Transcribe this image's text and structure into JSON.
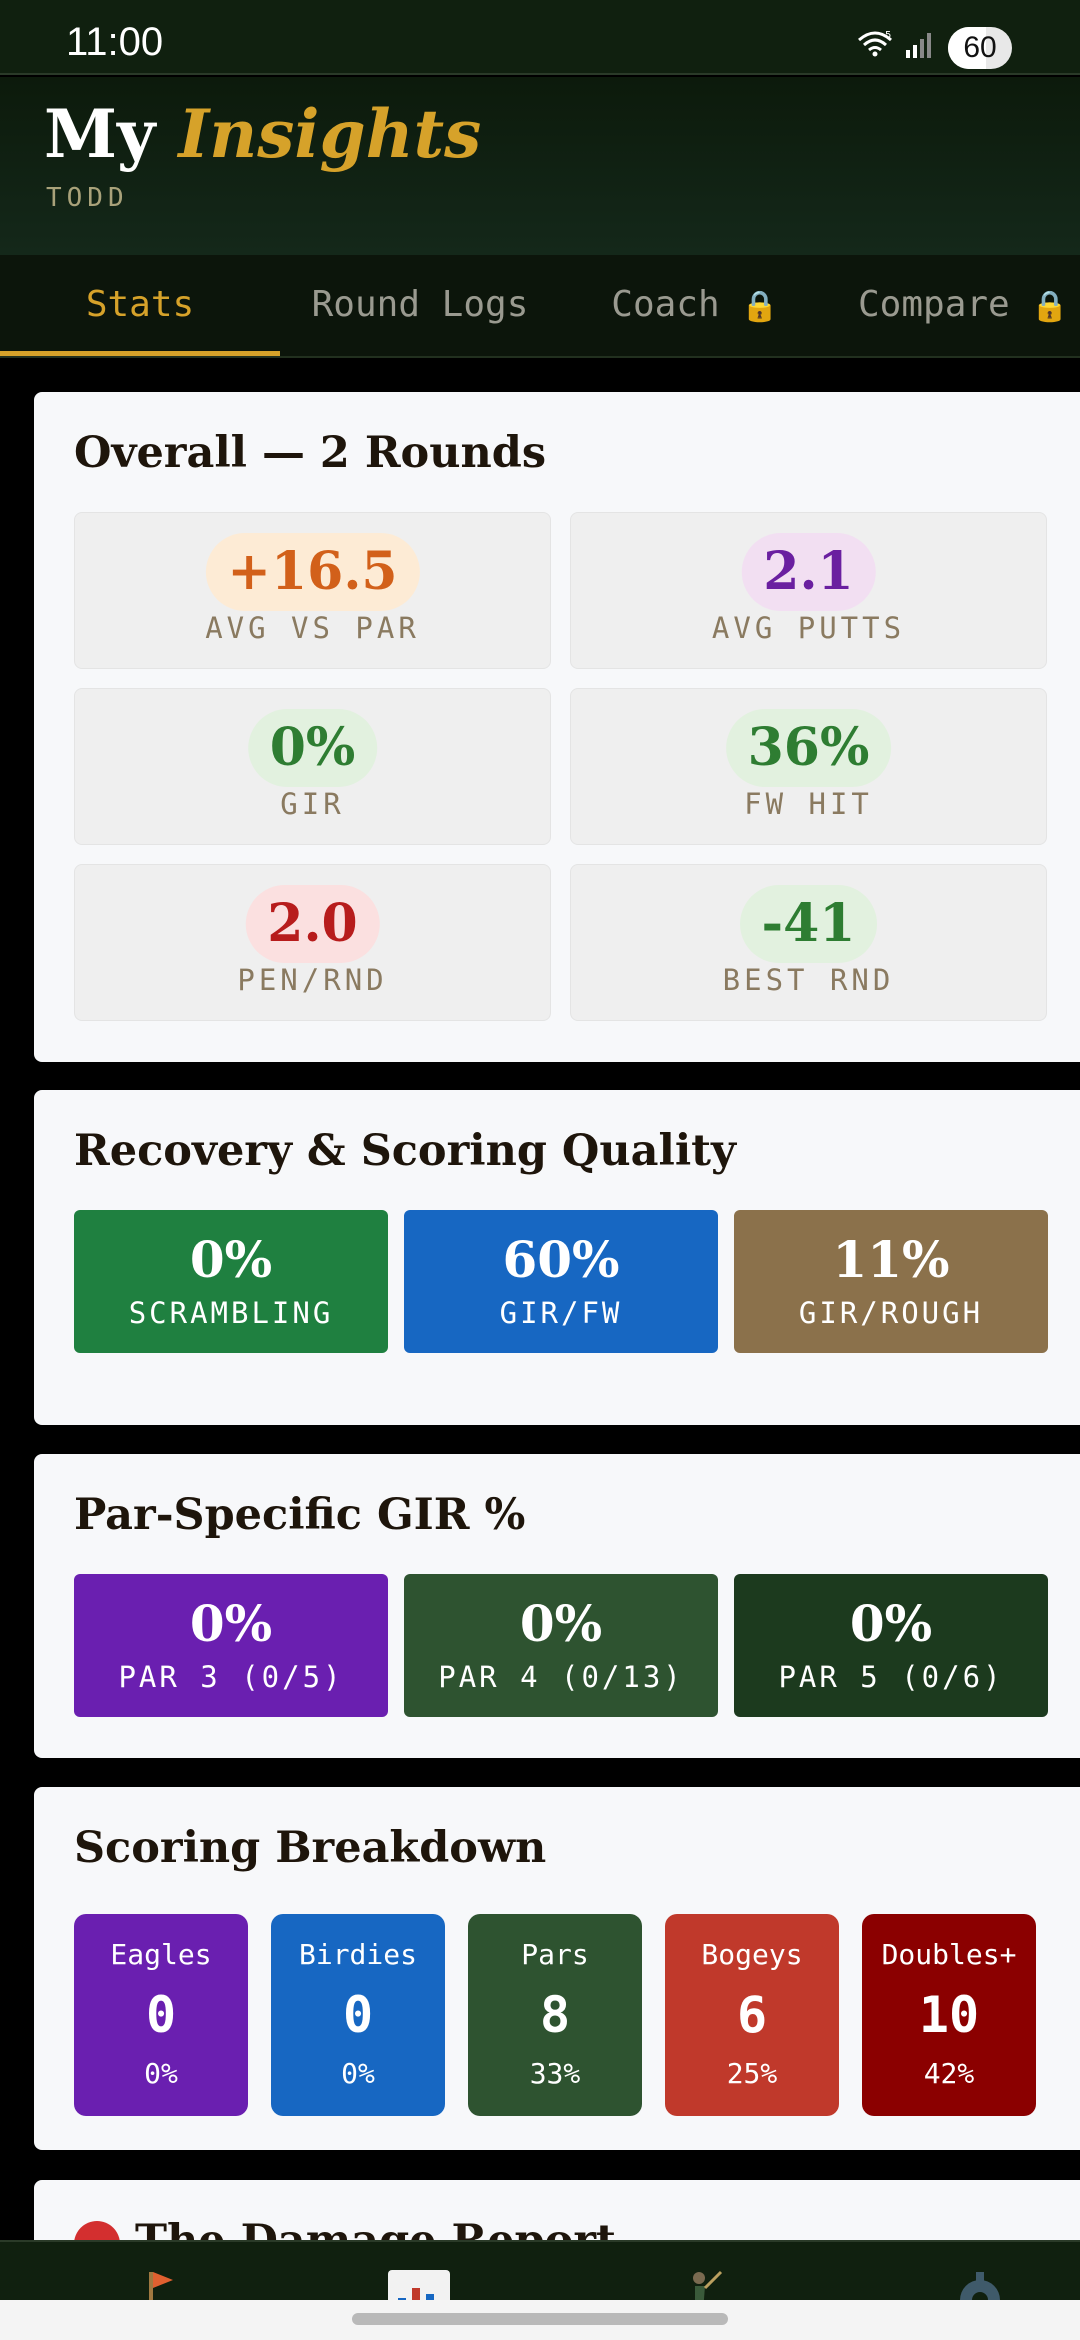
{
  "status_bar": {
    "time": "11:00",
    "battery": "60",
    "battery_level": 0.6,
    "network_badge": "5"
  },
  "header": {
    "title_plain": "My",
    "title_accent": "Insights",
    "user": "TODD"
  },
  "tabs": [
    {
      "label": "Stats",
      "active": true,
      "locked": false
    },
    {
      "label": "Round Logs",
      "active": false,
      "locked": false
    },
    {
      "label": "Coach",
      "active": false,
      "locked": true
    },
    {
      "label": "Compare",
      "active": false,
      "locked": true
    }
  ],
  "overall": {
    "title": "Overall — 2 Rounds",
    "stats": [
      {
        "value": "+16.5",
        "label": "AVG VS PAR",
        "color": "#d2601a",
        "bg": "#fdebd5"
      },
      {
        "value": "2.1",
        "label": "AVG PUTTS",
        "color": "#6a1fa0",
        "bg": "#f2dff2"
      },
      {
        "value": "0%",
        "label": "GIR",
        "color": "#2e7d32",
        "bg": "#e2f1df"
      },
      {
        "value": "36%",
        "label": "FW HIT",
        "color": "#2e7d32",
        "bg": "#e2f1df"
      },
      {
        "value": "2.0",
        "label": "PEN/RND",
        "color": "#b71c1c",
        "bg": "#fbe0e0"
      },
      {
        "value": "-41",
        "label": "BEST RND",
        "color": "#2e7d32",
        "bg": "#e2f1df"
      }
    ]
  },
  "recovery": {
    "title": "Recovery & Scoring Quality",
    "tiles": [
      {
        "value": "0%",
        "label": "SCRAMBLING",
        "color": "#1f8040"
      },
      {
        "value": "60%",
        "label": "GIR/FW",
        "color": "#1767c2"
      },
      {
        "value": "11%",
        "label": "GIR/ROUGH",
        "color": "#8b714b"
      }
    ]
  },
  "par_gir": {
    "title": "Par-Specific GIR %",
    "tiles": [
      {
        "value": "0%",
        "label": "PAR 3 (0/5)",
        "color": "#6a1fb0"
      },
      {
        "value": "0%",
        "label": "PAR 4 (0/13)",
        "color": "#2e5330"
      },
      {
        "value": "0%",
        "label": "PAR 5 (0/6)",
        "color": "#1c3a1e"
      }
    ]
  },
  "scoring": {
    "title": "Scoring Breakdown",
    "items": [
      {
        "name": "Eagles",
        "count": "0",
        "pct": "0%",
        "color": "#6a1fb0"
      },
      {
        "name": "Birdies",
        "count": "0",
        "pct": "0%",
        "color": "#1767c2"
      },
      {
        "name": "Pars",
        "count": "8",
        "pct": "33%",
        "color": "#2e5330"
      },
      {
        "name": "Bogeys",
        "count": "6",
        "pct": "25%",
        "color": "#c0392b"
      },
      {
        "name": "Doubles+",
        "count": "10",
        "pct": "42%",
        "color": "#8b0000"
      }
    ]
  },
  "damage": {
    "title": "The Damage Report",
    "icon": "red-circle-icon"
  },
  "nav": {
    "items": [
      "flag-icon",
      "chart-icon",
      "golfer-icon",
      "gear-icon"
    ],
    "active": "chart-icon"
  }
}
